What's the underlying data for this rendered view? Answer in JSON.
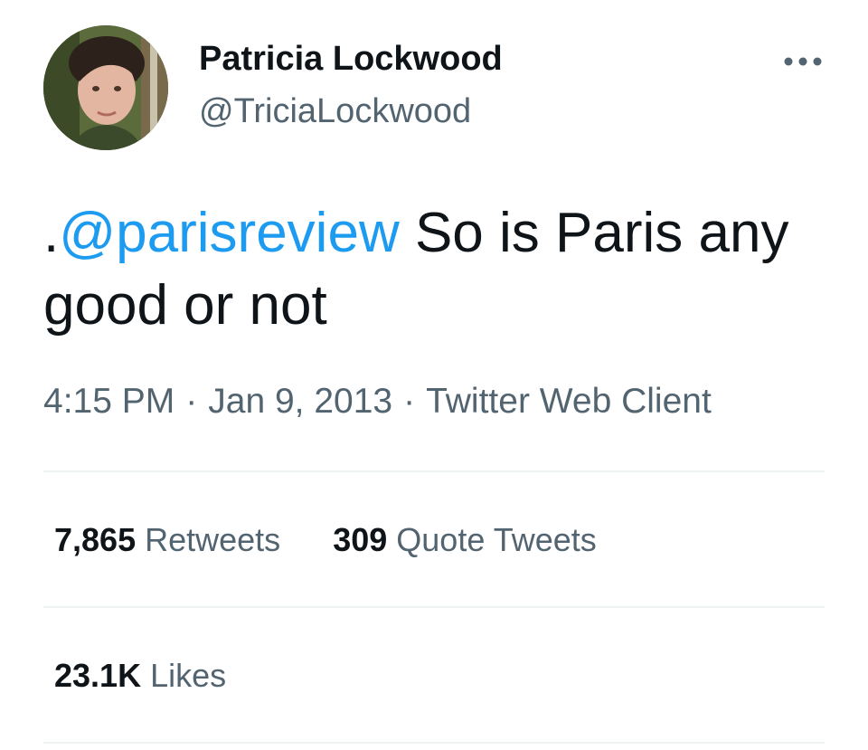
{
  "author": {
    "display_name": "Patricia Lockwood",
    "handle": "@TriciaLockwood",
    "avatar_icon": "profile-photo"
  },
  "more_icon": "more-horizontal-icon",
  "tweet": {
    "prefix": ".",
    "mention": "@parisreview",
    "body": " So is Paris any good or not"
  },
  "meta": {
    "time": "4:15 PM",
    "separator": "·",
    "date": "Jan 9, 2013",
    "client": "Twitter Web Client"
  },
  "stats": {
    "retweets": {
      "count": "7,865",
      "label": "Retweets"
    },
    "quote_tweets": {
      "count": "309",
      "label": "Quote Tweets"
    },
    "likes": {
      "count": "23.1K",
      "label": "Likes"
    }
  },
  "colors": {
    "text": "#0f1419",
    "secondary": "#536471",
    "link": "#1d9bf0",
    "divider": "#eff3f4"
  }
}
